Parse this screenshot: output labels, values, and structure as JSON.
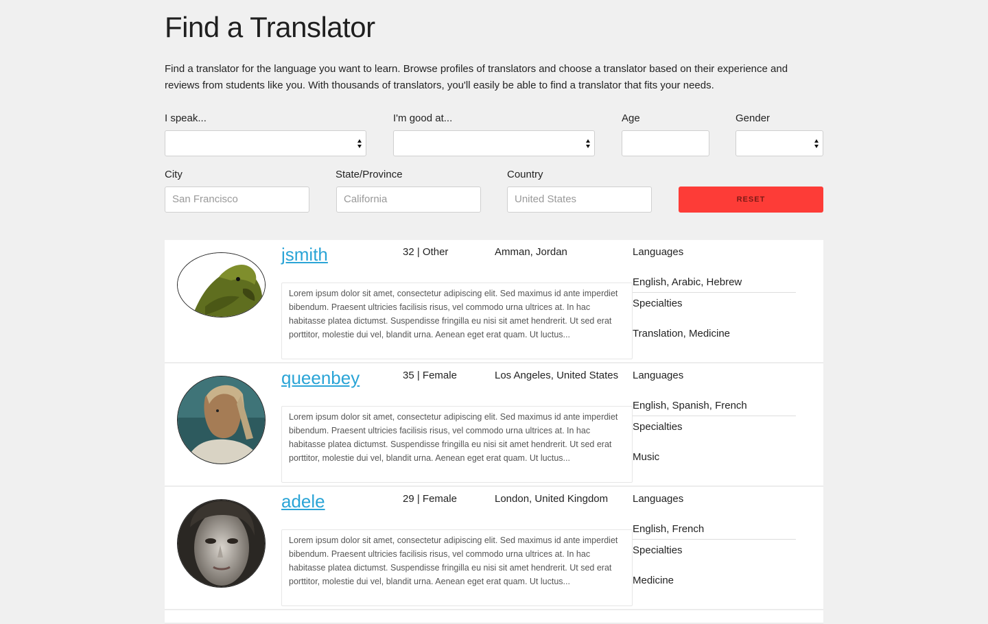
{
  "page": {
    "title": "Find a Translator",
    "intro": "Find a translator for the language you want to learn. Browse profiles of translators and choose a translator based on their experience and reviews from students like you. With thousands of translators, you'll easily be able to find a translator that fits your needs."
  },
  "filters": {
    "speak_label": "I speak...",
    "speak_value": "",
    "good_at_label": "I'm good at...",
    "good_at_value": "",
    "age_label": "Age",
    "age_value": "",
    "gender_label": "Gender",
    "gender_value": "",
    "city_label": "City",
    "city_placeholder": "San Francisco",
    "state_label": "State/Province",
    "state_placeholder": "California",
    "country_label": "Country",
    "country_placeholder": "United States",
    "reset_label": "RESET",
    "reset_color": "#fd3c37"
  },
  "translators": [
    {
      "username": "jsmith",
      "age_gender": "32 | Other",
      "location": "Amman, Jordan",
      "bio": "Lorem ipsum dolor sit amet, consectetur adipiscing elit. Sed maximus id ante imperdiet bibendum. Praesent ultricies facilisis risus, vel commodo urna ultrices at. In hac habitasse platea dictumst. Suspendisse fringilla eu nisi sit amet hendrerit. Ut sed erat porttitor, molestie dui vel, blandit urna. Aenean eget erat quam. Ut luctus...",
      "languages_label": "Languages",
      "languages": "English, Arabic, Hebrew",
      "specialties_label": "Specialties",
      "specialties": "Translation, Medicine",
      "avatar_icon": "parrot-avatar"
    },
    {
      "username": "queenbey",
      "age_gender": "35 | Female",
      "location": "Los Angeles, United States",
      "bio": "Lorem ipsum dolor sit amet, consectetur adipiscing elit. Sed maximus id ante imperdiet bibendum. Praesent ultricies facilisis risus, vel commodo urna ultrices at. In hac habitasse platea dictumst. Suspendisse fringilla eu nisi sit amet hendrerit. Ut sed erat porttitor, molestie dui vel, blandit urna. Aenean eget erat quam. Ut luctus...",
      "languages_label": "Languages",
      "languages": "English, Spanish, French",
      "specialties_label": "Specialties",
      "specialties": "Music",
      "avatar_icon": "woman-braids-avatar"
    },
    {
      "username": "adele",
      "age_gender": "29 | Female",
      "location": "London, United Kingdom",
      "bio": "Lorem ipsum dolor sit amet, consectetur adipiscing elit. Sed maximus id ante imperdiet bibendum. Praesent ultricies facilisis risus, vel commodo urna ultrices at. In hac habitasse platea dictumst. Suspendisse fringilla eu nisi sit amet hendrerit. Ut sed erat porttitor, molestie dui vel, blandit urna. Aenean eget erat quam. Ut luctus...",
      "languages_label": "Languages",
      "languages": "English, French",
      "specialties_label": "Specialties",
      "specialties": "Medicine",
      "avatar_icon": "woman-portrait-avatar"
    }
  ]
}
